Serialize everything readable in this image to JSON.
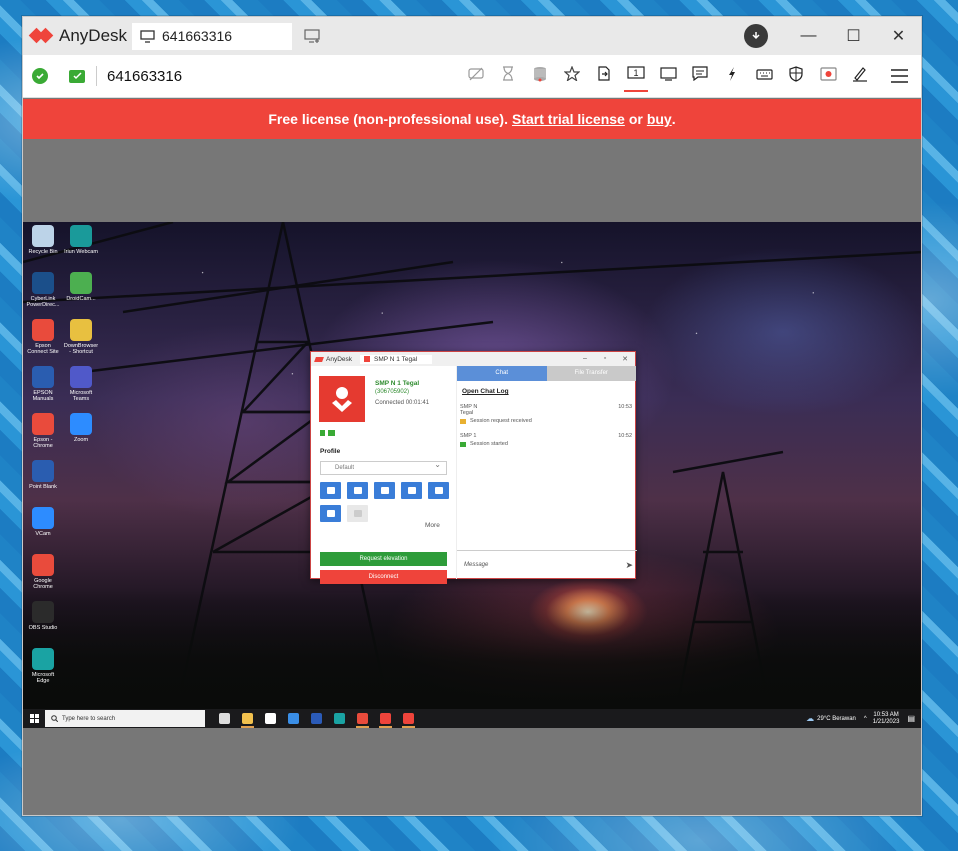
{
  "app": {
    "name": "AnyDesk",
    "tab_label": "641663316"
  },
  "toolbar": {
    "remote_id": "641663316",
    "icons": [
      "privacy-mode-icon",
      "hourglass-icon",
      "database-icon",
      "favorite-star-icon",
      "file-transfer-icon",
      "display-1-icon",
      "display-icon",
      "chat-icon",
      "actions-bolt-icon",
      "keyboard-icon",
      "permissions-shield-icon",
      "recording-icon",
      "whiteboard-pen-icon"
    ],
    "active_index": 5,
    "display_number": "1"
  },
  "banner": {
    "prefix": "Free license (non-professional use).",
    "trial_link": "Start trial license",
    "or": "or",
    "buy_link": "buy",
    "suffix": "."
  },
  "desktop_icons": [
    {
      "label": "Recycle Bin",
      "color": "#bcd3e8"
    },
    {
      "label": "Iriun Webcam",
      "color": "#1a9a9a"
    },
    {
      "label": "CyberLink PowerDirec...",
      "color": "#1b4f8a"
    },
    {
      "label": "DroidCam...",
      "color": "#4caf50"
    },
    {
      "label": "Epson Connect Site",
      "color": "#e94b3c"
    },
    {
      "label": "DownBrowser - Shortcut",
      "color": "#e8c040"
    },
    {
      "label": "EPSON Manuals",
      "color": "#2a5db0"
    },
    {
      "label": "Microsoft Teams",
      "color": "#5059c9"
    },
    {
      "label": "Epson - Chrome",
      "color": "#e94b3c"
    },
    {
      "label": "Zoom",
      "color": "#2d8cff"
    },
    {
      "label": "Point Blank",
      "color": "#2a5db0"
    },
    {
      "label": "VCam",
      "color": "#2d8cff"
    },
    {
      "label": "Google Chrome",
      "color": "#e94b3c"
    },
    {
      "label": "OBS Studio",
      "color": "#2b2b2b"
    },
    {
      "label": "Microsoft Edge",
      "color": "#1aa3a3"
    }
  ],
  "taskbar": {
    "search_placeholder": "Type here to search",
    "weather": "29°C  Berawan",
    "time": "10:53 AM",
    "date": "1/21/2023"
  },
  "remote_anydesk": {
    "app_name": "AnyDesk",
    "tab_label": "SMP N 1 Tegal",
    "host_name": "SMP N 1 Tegal",
    "host_id": "(306705902)",
    "connected": "Connected 00:01:41",
    "profile_label": "Profile",
    "profile_value": "Default",
    "more": "More",
    "request_elevation": "Request elevation",
    "disconnect": "Disconnect",
    "tab_chat": "Chat",
    "tab_file_transfer": "File Transfer",
    "open_chat_log": "Open Chat Log",
    "messages": [
      {
        "sender": "SMP N",
        "sender2": "Tegal",
        "time": "10:53",
        "text": "Session request received"
      },
      {
        "sender": "SMP 1",
        "time": "10:52",
        "text": "Session started"
      }
    ],
    "message_placeholder": "Message"
  }
}
